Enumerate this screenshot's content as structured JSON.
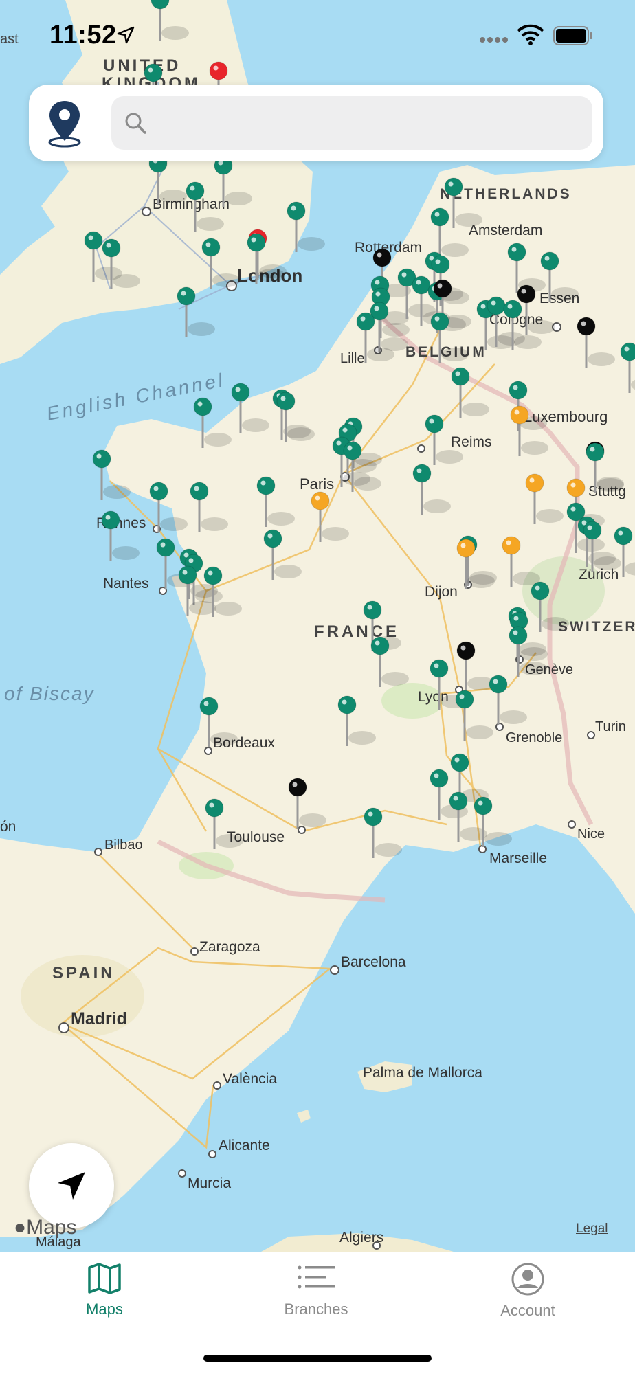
{
  "status": {
    "time": "11:52"
  },
  "search": {
    "placeholder": ""
  },
  "map": {
    "labels": {
      "united_kingdom": "UNITED",
      "kingdom": "KINGDOM",
      "birmingham": "Birmingham",
      "london": "London",
      "english_channel": "English Channel",
      "netherlands": "NETHERLANDS",
      "amsterdam": "Amsterdam",
      "rotterdam": "Rotterdam",
      "belgium": "BELGIUM",
      "lille": "Lille",
      "cologne": "Cologne",
      "essen": "Essen",
      "luxembourg": "Luxembourg",
      "reims": "Reims",
      "paris": "Paris",
      "stuttgart": "Stuttg",
      "rennes": "Rennes",
      "nantes": "Nantes",
      "dijon": "Dijon",
      "zurich": "Zürich",
      "france": "FRANCE",
      "switzerland": "SWITZER",
      "geneve": "Genève",
      "bay_of_biscay": "of Biscay",
      "lyon": "Lyon",
      "turin": "Turin",
      "grenoble": "Grenoble",
      "bordeaux": "Bordeaux",
      "toulouse": "Toulouse",
      "nice": "Nice",
      "marseille": "Marseille",
      "bilbao": "Bilbao",
      "zaragoza": "Zaragoza",
      "spain": "SPAIN",
      "barcelona": "Barcelona",
      "madrid": "Madrid",
      "valencia": "València",
      "palma": "Palma de Mallorca",
      "alicante": "Alicante",
      "murcia": "Murcia",
      "malaga": "Málaga",
      "algiers": "Algiers",
      "east": "ast",
      "corner_on": "ón"
    },
    "legal": "Legal",
    "attribution": "Maps",
    "pin_colors": {
      "green": "#0f8a6e",
      "black": "#0b0b0b",
      "orange": "#f5a623",
      "red": "#e8252b"
    }
  },
  "tabs": [
    {
      "label": "Maps",
      "icon": "map-icon",
      "active": true
    },
    {
      "label": "Branches",
      "icon": "list-icon",
      "active": false
    },
    {
      "label": "Account",
      "icon": "account-icon",
      "active": false
    }
  ],
  "colors": {
    "accent": "#13806a",
    "inactive": "#8b8b8b"
  }
}
